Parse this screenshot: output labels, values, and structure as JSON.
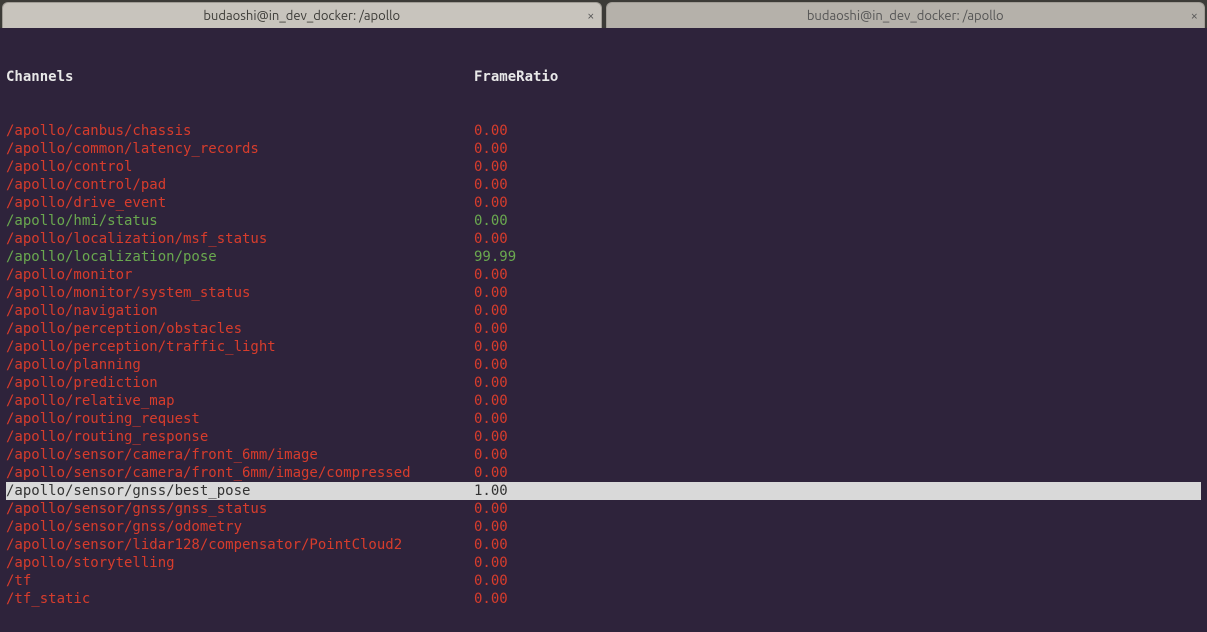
{
  "tabs": [
    {
      "title": "budaoshi@in_dev_docker: /apollo",
      "active": true
    },
    {
      "title": "budaoshi@in_dev_docker: /apollo",
      "active": false
    }
  ],
  "header": {
    "channels": "Channels",
    "frameratio": "FrameRatio"
  },
  "rows": [
    {
      "channel": "/apollo/canbus/chassis",
      "ratio": "0.00",
      "style": "red",
      "selected": false
    },
    {
      "channel": "/apollo/common/latency_records",
      "ratio": "0.00",
      "style": "red",
      "selected": false
    },
    {
      "channel": "/apollo/control",
      "ratio": "0.00",
      "style": "red",
      "selected": false
    },
    {
      "channel": "/apollo/control/pad",
      "ratio": "0.00",
      "style": "red",
      "selected": false
    },
    {
      "channel": "/apollo/drive_event",
      "ratio": "0.00",
      "style": "red",
      "selected": false
    },
    {
      "channel": "/apollo/hmi/status",
      "ratio": "0.00",
      "style": "green",
      "selected": false
    },
    {
      "channel": "/apollo/localization/msf_status",
      "ratio": "0.00",
      "style": "red",
      "selected": false
    },
    {
      "channel": "/apollo/localization/pose",
      "ratio": "99.99",
      "style": "green",
      "selected": false
    },
    {
      "channel": "/apollo/monitor",
      "ratio": "0.00",
      "style": "red",
      "selected": false
    },
    {
      "channel": "/apollo/monitor/system_status",
      "ratio": "0.00",
      "style": "red",
      "selected": false
    },
    {
      "channel": "/apollo/navigation",
      "ratio": "0.00",
      "style": "red",
      "selected": false
    },
    {
      "channel": "/apollo/perception/obstacles",
      "ratio": "0.00",
      "style": "red",
      "selected": false
    },
    {
      "channel": "/apollo/perception/traffic_light",
      "ratio": "0.00",
      "style": "red",
      "selected": false
    },
    {
      "channel": "/apollo/planning",
      "ratio": "0.00",
      "style": "red",
      "selected": false
    },
    {
      "channel": "/apollo/prediction",
      "ratio": "0.00",
      "style": "red",
      "selected": false
    },
    {
      "channel": "/apollo/relative_map",
      "ratio": "0.00",
      "style": "red",
      "selected": false
    },
    {
      "channel": "/apollo/routing_request",
      "ratio": "0.00",
      "style": "red",
      "selected": false
    },
    {
      "channel": "/apollo/routing_response",
      "ratio": "0.00",
      "style": "red",
      "selected": false
    },
    {
      "channel": "/apollo/sensor/camera/front_6mm/image",
      "ratio": "0.00",
      "style": "red",
      "selected": false
    },
    {
      "channel": "/apollo/sensor/camera/front_6mm/image/compressed",
      "ratio": "0.00",
      "style": "red",
      "selected": false
    },
    {
      "channel": "/apollo/sensor/gnss/best_pose",
      "ratio": "1.00",
      "style": "sel",
      "selected": true
    },
    {
      "channel": "/apollo/sensor/gnss/gnss_status",
      "ratio": "0.00",
      "style": "red",
      "selected": false
    },
    {
      "channel": "/apollo/sensor/gnss/odometry",
      "ratio": "0.00",
      "style": "red",
      "selected": false
    },
    {
      "channel": "/apollo/sensor/lidar128/compensator/PointCloud2",
      "ratio": "0.00",
      "style": "red",
      "selected": false
    },
    {
      "channel": "/apollo/storytelling",
      "ratio": "0.00",
      "style": "red",
      "selected": false
    },
    {
      "channel": "/tf",
      "ratio": "0.00",
      "style": "red",
      "selected": false
    },
    {
      "channel": "/tf_static",
      "ratio": "0.00",
      "style": "red",
      "selected": false
    }
  ]
}
